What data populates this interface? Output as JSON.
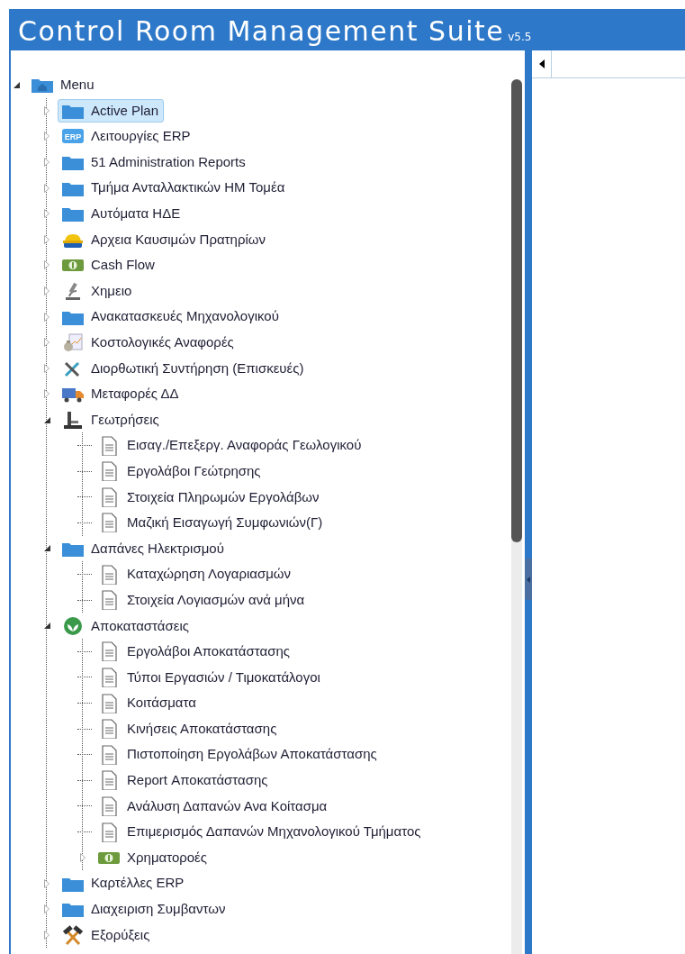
{
  "header": {
    "title": "Control Room Management Suite",
    "version": "v5.5"
  },
  "tree": [
    {
      "label": "Menu",
      "kind": "home-folder",
      "expanded": true,
      "selected": false,
      "children": [
        {
          "label": "Active Plan",
          "kind": "folder",
          "expanded": false,
          "selected": true
        },
        {
          "label": "Λειτουργίες ERP",
          "kind": "erp",
          "badge": "ERP",
          "expanded": false,
          "selected": false
        },
        {
          "label": "51 Administration Reports",
          "kind": "folder",
          "expanded": false,
          "selected": false
        },
        {
          "label": "Τμήμα Ανταλλακτικών ΗΜ Τομέα",
          "kind": "folder",
          "expanded": false,
          "selected": false
        },
        {
          "label": "Αυτόματα ΗΔΕ",
          "kind": "folder",
          "expanded": false,
          "selected": false
        },
        {
          "label": "Αρχεια Καυσιμών Πρατηρίων",
          "kind": "hard-hat",
          "expanded": false,
          "selected": false
        },
        {
          "label": "Cash Flow",
          "kind": "cash",
          "expanded": false,
          "selected": false
        },
        {
          "label": "Χημειο",
          "kind": "microscope",
          "expanded": false,
          "selected": false
        },
        {
          "label": "Ανακατασκευές Μηχανολογικού",
          "kind": "folder",
          "expanded": false,
          "selected": false
        },
        {
          "label": "Κοστολογικές Αναφορές",
          "kind": "money-bag",
          "expanded": false,
          "selected": false
        },
        {
          "label": "Διορθωτική Συντήρηση (Επισκευές)",
          "kind": "tools",
          "expanded": false,
          "selected": false
        },
        {
          "label": "Μεταφορές ΔΔ",
          "kind": "truck",
          "expanded": false,
          "selected": false
        },
        {
          "label": "Γεωτρήσεις",
          "kind": "drill",
          "expanded": true,
          "selected": false,
          "children": [
            {
              "label": "Εισαγ./Επεξεργ. Αναφοράς Γεωλογικού",
              "kind": "document",
              "selected": false
            },
            {
              "label": "Εργολάβοι Γεώτρησης",
              "kind": "document",
              "selected": false
            },
            {
              "label": "Στοιχεία Πληρωμών Εργολάβων",
              "kind": "document",
              "selected": false
            },
            {
              "label": "Μαζική Εισαγωγή Συμφωνιών(Γ)",
              "kind": "document",
              "selected": false
            }
          ]
        },
        {
          "label": "Δαπάνες Ηλεκτρισμού",
          "kind": "folder",
          "expanded": true,
          "selected": false,
          "children": [
            {
              "label": "Καταχώρηση Λογαριασμών",
              "kind": "document",
              "selected": false
            },
            {
              "label": "Στοιχεία Λογιασμών ανά μήνα",
              "kind": "document",
              "selected": false
            }
          ]
        },
        {
          "label": "Αποκαταστάσεις",
          "kind": "leaf",
          "expanded": true,
          "selected": false,
          "children": [
            {
              "label": "Εργολάβοι Αποκατάστασης",
              "kind": "document",
              "selected": false
            },
            {
              "label": "Τύποι Εργασιών / Τιμοκατάλογοι",
              "kind": "document",
              "selected": false
            },
            {
              "label": "Κοιτάσματα",
              "kind": "document",
              "selected": false
            },
            {
              "label": "Κινήσεις Αποκατάστασης",
              "kind": "document",
              "selected": false
            },
            {
              "label": "Πιστοποίηση Εργολάβων Αποκατάστασης",
              "kind": "document",
              "selected": false
            },
            {
              "label": "Report Αποκατάστασης",
              "kind": "document",
              "selected": false
            },
            {
              "label": "Ανάλυση Δαπανών Ανα Κοίτασμα",
              "kind": "document",
              "selected": false
            },
            {
              "label": "Επιμερισμός Δαπανών Μηχανολογικού Τμήματος",
              "kind": "document",
              "selected": false
            },
            {
              "label": "Χρηματοροές",
              "kind": "cash",
              "expanded": false,
              "selected": false
            }
          ]
        },
        {
          "label": "Καρτέλλες ERP",
          "kind": "folder",
          "expanded": false,
          "selected": false
        },
        {
          "label": "Διαχειριση Συμβαντων",
          "kind": "folder",
          "expanded": false,
          "selected": false
        },
        {
          "label": "Εξορύξεις",
          "kind": "hammers",
          "expanded": false,
          "selected": false
        }
      ]
    }
  ]
}
